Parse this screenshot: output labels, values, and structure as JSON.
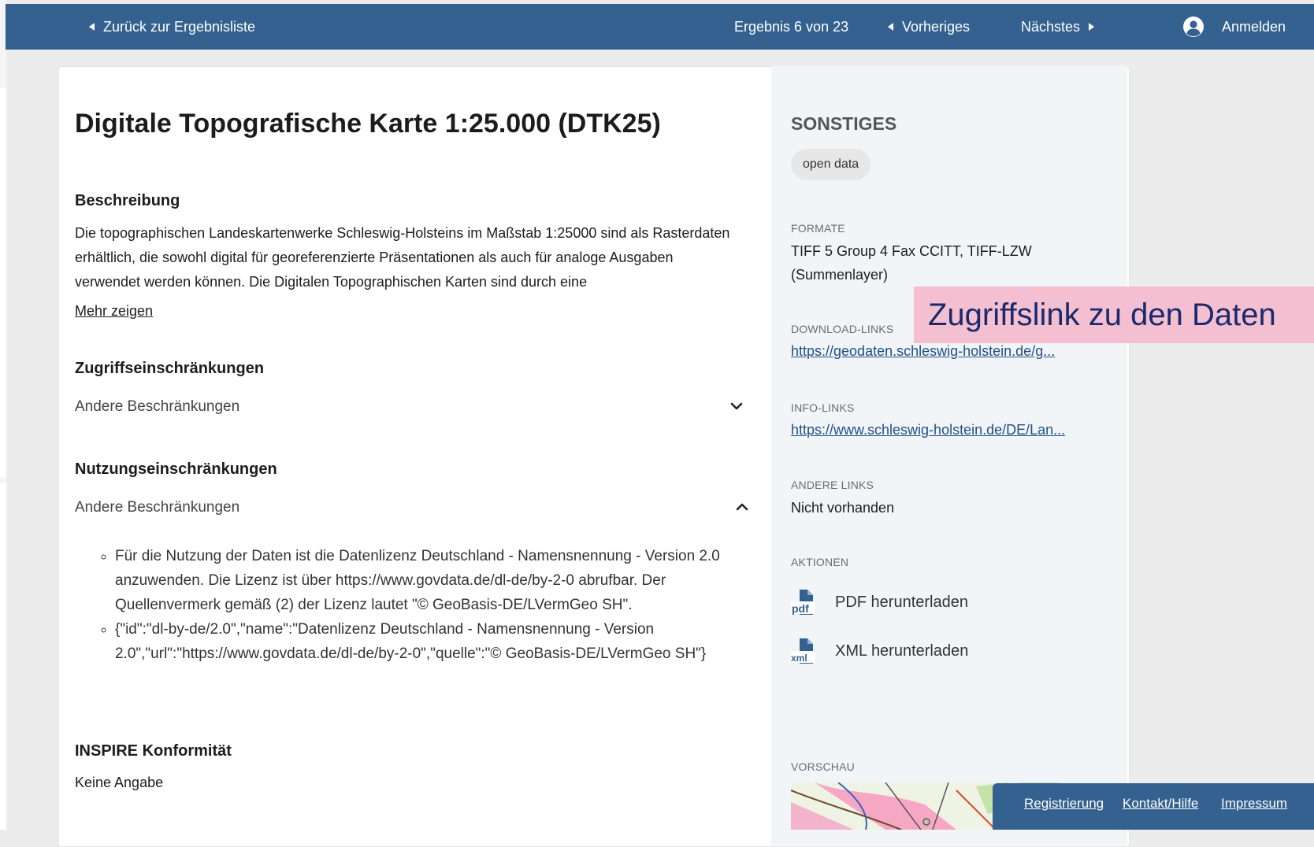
{
  "nav": {
    "back_label": "Zurück zur Ergebnisliste",
    "result_info": "Ergebnis 6 von 23",
    "prev_label": "Vorheriges",
    "next_label": "Nächstes",
    "login_label": "Anmelden"
  },
  "main": {
    "title": "Digitale Topografische Karte 1:25.000 (DTK25)",
    "description_heading": "Beschreibung",
    "description_text": "Die topographischen Landeskartenwerke Schleswig-Holsteins im Maßstab 1:25000 sind als Rasterdaten erhältlich, die sowohl digital für georeferenzierte Präsentationen als auch für analoge Ausgaben verwendet werden können. Die Digitalen Topographischen Karten sind durch eine",
    "more_label": "Mehr zeigen",
    "access_heading": "Zugriffseinschränkungen",
    "access_value": "Andere Beschränkungen",
    "usage_heading": "Nutzungseinschränkungen",
    "usage_value": "Andere Beschränkungen",
    "usage_items": [
      "Für die Nutzung der Daten ist die Datenlizenz Deutschland - Namensnennung - Version 2.0 anzuwenden. Die Lizenz ist über https://www.govdata.de/dl-de/by-2-0 abrufbar. Der Quellenvermerk gemäß (2) der Lizenz lautet \"© GeoBasis-DE/LVermGeo SH\".",
      "{\"id\":\"dl-by-de/2.0\",\"name\":\"Datenlizenz Deutschland - Namensnennung - Version 2.0\",\"url\":\"https://www.govdata.de/dl-de/by-2-0\",\"quelle\":\"© GeoBasis-DE/LVermGeo SH\"}"
    ],
    "inspire_heading": "INSPIRE Konformität",
    "inspire_value": "Keine Angabe"
  },
  "sidebar": {
    "heading": "SONSTIGES",
    "tag": "open data",
    "formats_label": "FORMATE",
    "formats_value": "TIFF 5 Group 4 Fax CCITT, TIFF-LZW (Summenlayer)",
    "download_label": "DOWNLOAD-LINKS",
    "download_link": "https://geodaten.schleswig-holstein.de/g...",
    "info_label": "INFO-LINKS",
    "info_link": "https://www.schleswig-holstein.de/DE/Lan...",
    "other_label": "ANDERE LINKS",
    "other_value": "Nicht vorhanden",
    "actions_label": "AKTIONEN",
    "pdf_label": "PDF herunterladen",
    "xml_label": "XML herunterladen",
    "preview_label": "VORSCHAU"
  },
  "callout": "Zugriffslink zu den Daten",
  "footer": {
    "register": "Registrierung",
    "contact": "Kontakt/Hilfe",
    "imprint": "Impressum"
  }
}
